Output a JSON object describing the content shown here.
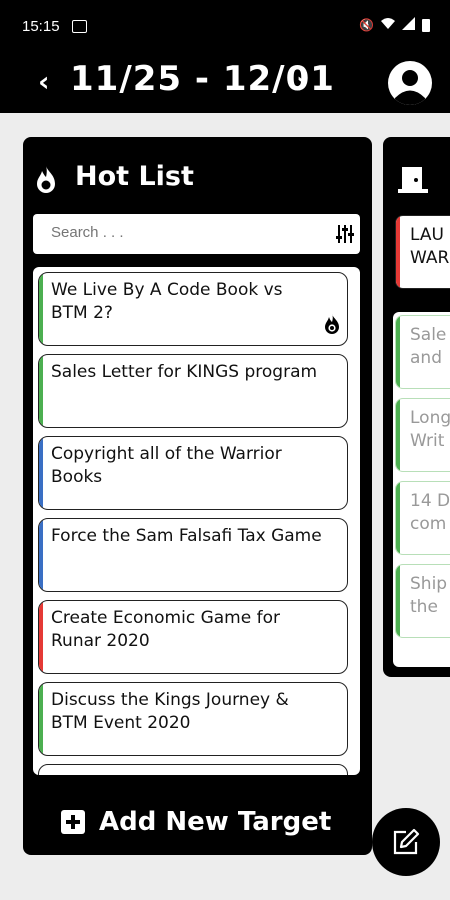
{
  "status": {
    "time": "15:15"
  },
  "header": {
    "date_range": "11/25 - 12/01",
    "prev": "‹",
    "next": "›"
  },
  "hot_list": {
    "title": "Hot List",
    "search_placeholder": "Search . . .",
    "items": [
      {
        "text": "We Live By A Code Book vs BTM 2?",
        "stripe": "#4caf50"
      },
      {
        "text": "Sales Letter for KINGS program",
        "stripe": "#4caf50"
      },
      {
        "text": "Copyright all of the Warrior Books",
        "stripe": "#3a6fc4"
      },
      {
        "text": "Force the Sam Falsafi Tax Game",
        "stripe": "#3a6fc4"
      },
      {
        "text": "Create Economic Game for Runar 2020",
        "stripe": "#e53935"
      },
      {
        "text": "Discuss the Kings Journey & BTM Event 2020",
        "stripe": "#4caf50"
      }
    ],
    "add_label": "Add New Target"
  },
  "second_panel": {
    "top_card": {
      "line1": "LAU",
      "line2": "WAR",
      "stripe": "#e53935"
    },
    "cards": [
      {
        "line1": "Sale",
        "line2": "and"
      },
      {
        "line1": "Long",
        "line2": "Writ"
      },
      {
        "line1": "14 D",
        "line2": "com"
      },
      {
        "line1": "Ship",
        "line2": "the"
      }
    ]
  },
  "icons": {
    "flame": "flame-icon",
    "filter": "filter-sliders-icon",
    "avatar": "user-avatar-icon",
    "fab": "edit-icon",
    "door": "door-icon",
    "hot": "hot-flame-icon"
  }
}
